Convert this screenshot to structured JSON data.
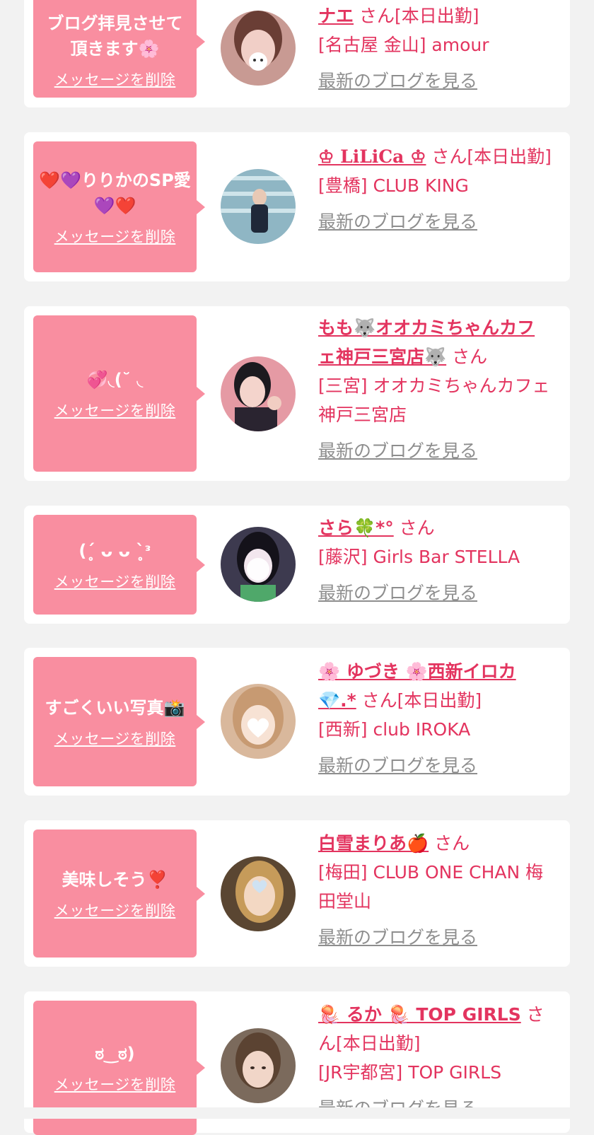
{
  "items": [
    {
      "message": "ブログ拝見させて頂きます🌸",
      "delete_label": "メッセージを削除",
      "name": "ナエ",
      "suffix": " さん[本日出勤]",
      "shop": "[名古屋 金山] amour",
      "blog_link": "最新のブログを見る"
    },
    {
      "message": "❤️💜りりかのSP愛💜❤️",
      "delete_label": "メッセージを削除",
      "name": "♔ LiLiCa ♔",
      "suffix": " さん[本日出勤]",
      "shop": "[豊橋] CLUB KING",
      "blog_link": "最新のブログを見る"
    },
    {
      "message": "💞◟(˘ ◟",
      "delete_label": "メッセージを削除",
      "name": "もも🐺オオカミちゃんカフェ神戸三宮店🐺",
      "suffix": " さん",
      "shop": "[三宮] オオカミちゃんカフェ神戸三宮店",
      "blog_link": "最新のブログを見る"
    },
    {
      "message": "(ˊ̥ ᴗ ᴗ ˋ̥ᵌ",
      "delete_label": "メッセージを削除",
      "name": "さら🍀*°",
      "suffix": " さん",
      "shop": "[藤沢] Girls Bar STELLA",
      "blog_link": "最新のブログを見る"
    },
    {
      "message": "すごくいい写真📸",
      "delete_label": "メッセージを削除",
      "name": "🌸 ゆづき 🌸西新イロカ💎.*",
      "suffix": " さん[本日出勤]",
      "shop": "[西新] club IROKA",
      "blog_link": "最新のブログを見る"
    },
    {
      "message": "美味しそう❣️",
      "delete_label": "メッセージを削除",
      "name": "白雪まりあ🍎",
      "suffix": " さん",
      "shop": "[梅田] CLUB ONE CHAN 梅田堂山",
      "blog_link": "最新のブログを見る"
    },
    {
      "message": "ಠ‿ಠ)",
      "delete_label": "メッセージを削除",
      "name": "🪼 るか 🪼 TOP GIRLS",
      "suffix": " さん[本日出勤]",
      "shop": "[JR宇都宮] TOP GIRLS",
      "blog_link": "最新のブログを見る"
    }
  ],
  "colors": {
    "bubble": "#f98ea0",
    "accent": "#e3345f",
    "link_gray": "#8e8e8e",
    "background": "#f2f2f2"
  }
}
